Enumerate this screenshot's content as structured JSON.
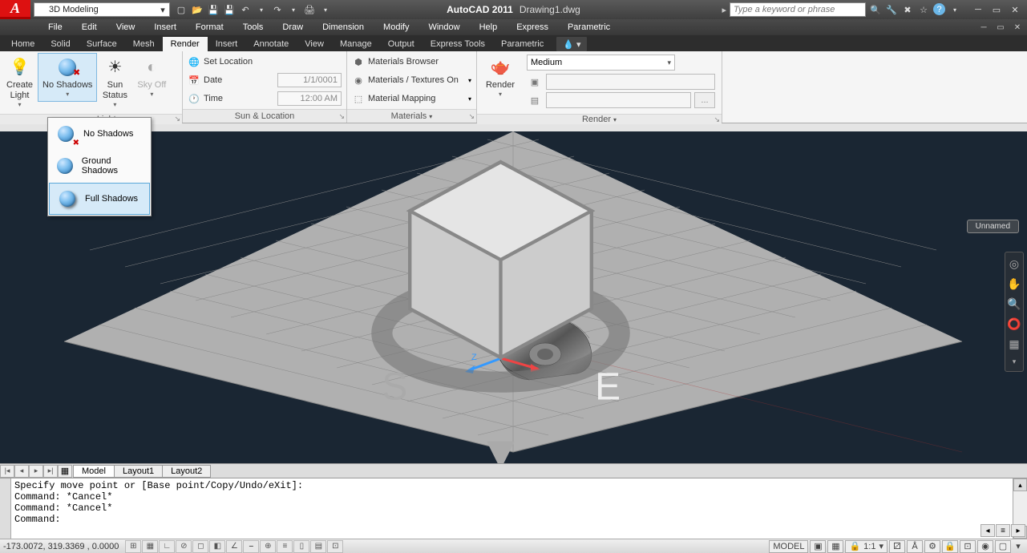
{
  "title": {
    "app": "AutoCAD 2011",
    "doc": "Drawing1.dwg"
  },
  "workspace": "3D Modeling",
  "search_placeholder": "Type a keyword or phrase",
  "menus": [
    "File",
    "Edit",
    "View",
    "Insert",
    "Format",
    "Tools",
    "Draw",
    "Dimension",
    "Modify",
    "Window",
    "Help",
    "Express",
    "Parametric"
  ],
  "ribbon_tabs": [
    "Home",
    "Solid",
    "Surface",
    "Mesh",
    "Render",
    "Insert",
    "Annotate",
    "View",
    "Manage",
    "Output",
    "Express Tools",
    "Parametric"
  ],
  "ribbon_active": "Render",
  "panels": {
    "lights": {
      "title": "Lights",
      "create_light": "Create\nLight",
      "no_shadows": "No Shadows",
      "sun_status": "Sun\nStatus",
      "sky_off": "Sky Off"
    },
    "sunloc": {
      "title": "Sun & Location",
      "set_location": "Set Location",
      "date_label": "Date",
      "date_val": "1/1/0001",
      "time_label": "Time",
      "time_val": "12:00 AM"
    },
    "materials": {
      "title": "Materials",
      "browser": "Materials Browser",
      "textures": "Materials / Textures On",
      "mapping": "Material Mapping"
    },
    "render": {
      "title": "Render",
      "btn": "Render",
      "preset": "Medium",
      "ellipsis": "..."
    }
  },
  "shadow_menu": [
    "No Shadows",
    "Ground Shadows",
    "Full Shadows"
  ],
  "shadow_hover": 2,
  "viewcube_label": "Unnamed",
  "layout_tabs": [
    "Model",
    "Layout1",
    "Layout2"
  ],
  "layout_active": 0,
  "command_lines": [
    "Specify move point or [Base point/Copy/Undo/eXit]:",
    "Command: *Cancel*",
    "Command: *Cancel*",
    "Command:"
  ],
  "coords": "-173.0072, 319.3369 , 0.0000",
  "status_right": {
    "space": "MODEL",
    "scale": "1:1"
  }
}
